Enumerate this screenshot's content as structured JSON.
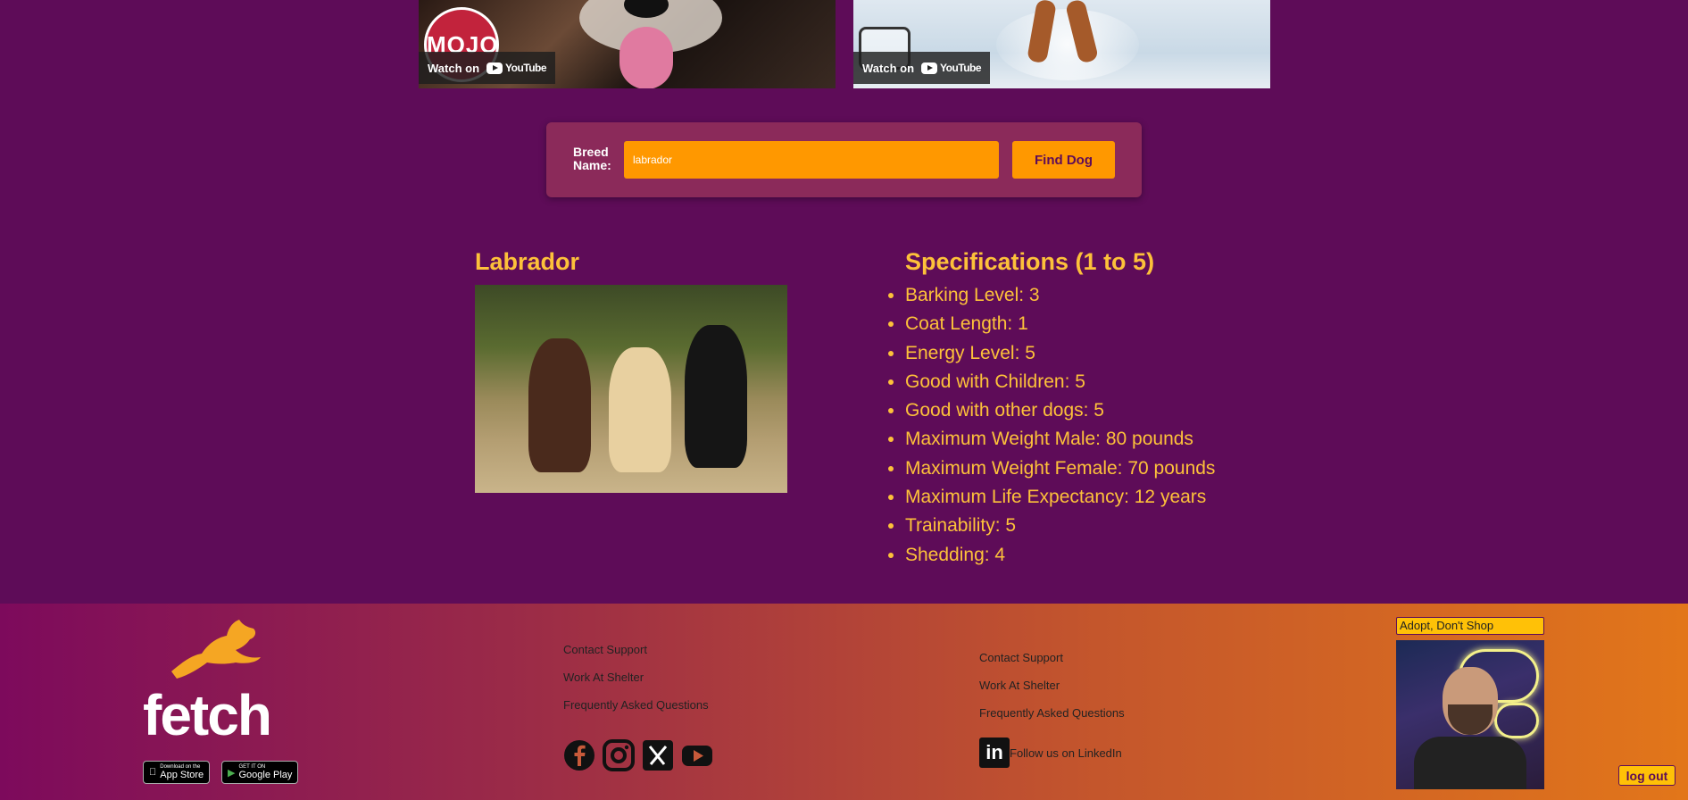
{
  "videos": [
    {
      "channel_logo_text": "MOJO",
      "watch_label": "Watch on",
      "platform": "YouTube"
    },
    {
      "channel_logo_text": "",
      "watch_label": "Watch on",
      "platform": "YouTube"
    }
  ],
  "search": {
    "label": "Breed Name:",
    "value": "labrador",
    "button_label": "Find Dog"
  },
  "breed": {
    "name": "Labrador",
    "specs_title": "Specifications (1 to 5)",
    "specs": [
      "Barking Level: 3",
      "Coat Length: 1",
      "Energy Level: 5",
      "Good with Children: 5",
      "Good with other dogs: 5",
      "Maximum Weight Male: 80 pounds",
      "Maximum Weight Female: 70 pounds",
      "Maximum Life Expectancy: 12 years",
      "Trainability: 5",
      "Shedding: 4"
    ]
  },
  "footer": {
    "brand": "fetch",
    "app_store": {
      "small": "Download on the",
      "big": "App Store"
    },
    "google_play": {
      "small": "GET IT ON",
      "big": "Google Play"
    },
    "links_col1": [
      "Contact Support",
      "Work At Shelter",
      "Frequently Asked Questions"
    ],
    "links_col2": [
      "Contact Support",
      "Work At Shelter",
      "Frequently Asked Questions"
    ],
    "social_icons": [
      "facebook-icon",
      "instagram-icon",
      "x-icon",
      "youtube-icon"
    ],
    "linkedin_label": "Follow us on LinkedIn",
    "adopt_label": "Adopt, Don't Shop",
    "logout_label": "log out"
  },
  "colors": {
    "background": "#5e0c58",
    "accent": "#ff9800",
    "heading": "#fdc13a"
  }
}
